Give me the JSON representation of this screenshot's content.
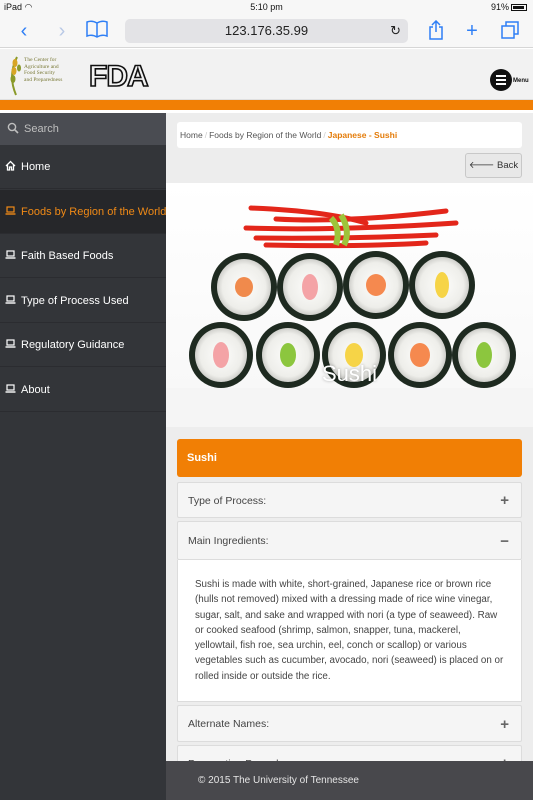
{
  "status_bar": {
    "device": "iPad",
    "time": "5:10 pm",
    "battery": "91%"
  },
  "browser": {
    "url": "123.176.35.99"
  },
  "header": {
    "center_logo_lines": [
      "The Center for",
      "Agriculture and",
      "Food Security",
      "and Preparedness"
    ],
    "fda_logo_text": "FDA",
    "menu_label": "Menu"
  },
  "sidebar": {
    "search_placeholder": "Search",
    "items": [
      {
        "label": "Home",
        "icon": "home-icon"
      },
      {
        "label": "Foods by Region of the World",
        "icon": "laptop-icon",
        "active": true
      },
      {
        "label": "Faith Based Foods",
        "icon": "laptop-icon"
      },
      {
        "label": "Type of Process Used",
        "icon": "laptop-icon"
      },
      {
        "label": "Regulatory Guidance",
        "icon": "laptop-icon"
      },
      {
        "label": "About",
        "icon": "laptop-icon"
      }
    ]
  },
  "breadcrumb": {
    "home": "Home",
    "region": "Foods by Region of the World",
    "current": "Japanese - Sushi"
  },
  "back_button": {
    "label": "Back"
  },
  "hero": {
    "caption": "Sushi"
  },
  "panel": {
    "title": "Sushi"
  },
  "accordion": [
    {
      "title": "Type of Process:",
      "toggle": "+"
    },
    {
      "title": "Main Ingredients:",
      "toggle": "−",
      "body": "Sushi is made with white, short-grained, Japanese rice or brown rice (hulls not removed) mixed with a dressing made of rice wine vinegar, sugar, salt, and sake and wrapped with nori (a type of seaweed). Raw or cooked seafood (shrimp, salmon, snapper, tuna, mackerel, yellowtail, fish roe, sea urchin, eel, conch or scallop) or various vegetables such as cucumber, avocado, nori (seaweed) is placed on or rolled inside or outside the rice."
    },
    {
      "title": "Alternate Names:",
      "toggle": "+"
    },
    {
      "title": "Preparation Procedure:",
      "toggle": "+"
    }
  ],
  "footer": {
    "text": "© 2015 The University of Tennessee"
  },
  "colors": {
    "accent": "#f17f05",
    "sidebar": "#333539",
    "active_text": "#f08a16",
    "link": "#2f7ff5"
  }
}
